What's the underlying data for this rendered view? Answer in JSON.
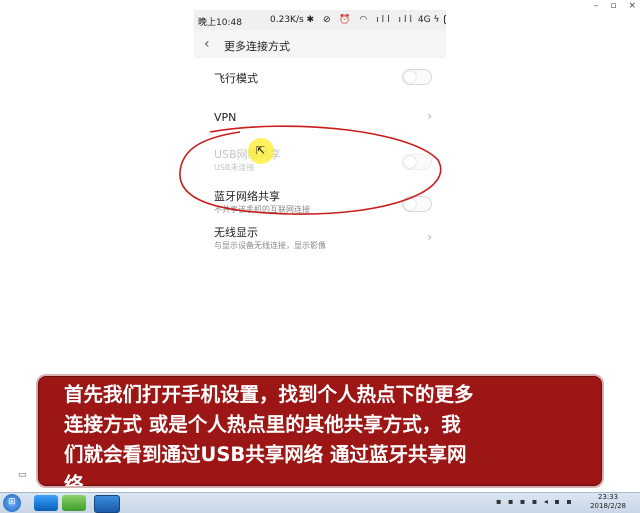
{
  "window": {
    "minimize": "–",
    "maximize": "▫",
    "close": "×"
  },
  "phone": {
    "status": {
      "time": "晚上10:48",
      "speed": "0.23K/s",
      "icons": "✱ ⊘ ⏰ ◠ ıll ıll",
      "network": "4G",
      "bolt": "ϟ",
      "battery_level": 0.85,
      "battery_color": "#46b84a"
    },
    "title": "更多连接方式",
    "rows": [
      {
        "label": "飞行模式",
        "sub": "",
        "control": "toggle",
        "on": false,
        "enabled": true
      },
      {
        "label": "VPN",
        "sub": "",
        "control": "chevron",
        "enabled": true
      },
      {
        "label": "USB网络共享",
        "sub": "USB未连接",
        "control": "toggle",
        "on": false,
        "enabled": false
      },
      {
        "label": "蓝牙网络共享",
        "sub": "不共享该手机的互联网连接",
        "control": "toggle",
        "on": false,
        "enabled": true
      },
      {
        "label": "无线显示",
        "sub": "与显示设备无线连接，显示影像",
        "control": "chevron",
        "enabled": true
      }
    ]
  },
  "caption": {
    "text": "首先我们打开手机设置，找到个人热点下的更多\n连接方式 或是个人热点里的其他共享方式，我\n们就会看到通过USB共享网络 通过蓝牙共享网\n络",
    "bg_color": "#9c1616"
  },
  "annotation": {
    "color": "#c81e1e"
  },
  "taskbar": {
    "clock_time": "23:33",
    "clock_date": "2018/2/28",
    "tray_icons": "▪ ▪ ▪ ▪ ◂ ▪ ▪"
  },
  "icons": {
    "back": "‹",
    "chevron": "›",
    "cursor": "⇱",
    "side": "▭"
  }
}
